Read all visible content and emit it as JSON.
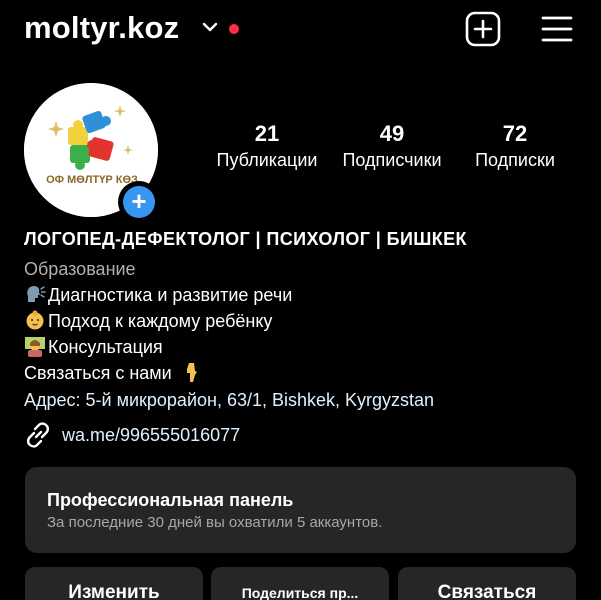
{
  "header": {
    "username": "moltyr.koz",
    "notification_color": "#ff3040",
    "icons": [
      "chevron-down-icon",
      "add-post-icon",
      "menu-icon"
    ]
  },
  "profile": {
    "avatar_text": "ОФ МӨЛТҮР КӨЗ",
    "stats": [
      {
        "value": "21",
        "label": "Публикации"
      },
      {
        "value": "49",
        "label": "Подписчики"
      },
      {
        "value": "72",
        "label": "Подписки"
      }
    ]
  },
  "bio": {
    "title": "ЛОГОПЕД-ДЕФЕКТОЛОГ | ПСИХОЛОГ | БИШКЕК",
    "category": "Образование",
    "line1": "Диагностика и развитие речи",
    "line2": "Подход к каждому ребёнку",
    "line3": "Консультация",
    "line4": "Связаться с нами",
    "address": "Адрес: 5-й микрорайон, 63/1, Bishkek, Kyrgyzstan",
    "link": "wa.me/996555016077"
  },
  "pro_panel": {
    "title": "Профессиональная панель",
    "subtitle": "За последние 30 дней вы охватили 5 аккаунтов."
  },
  "buttons": {
    "edit": "Изменить",
    "share": "Поделиться пр...",
    "contact": "Связаться"
  },
  "colors": {
    "accent": "#3797f0",
    "panel": "#262626",
    "link": "#e0f1ff"
  }
}
